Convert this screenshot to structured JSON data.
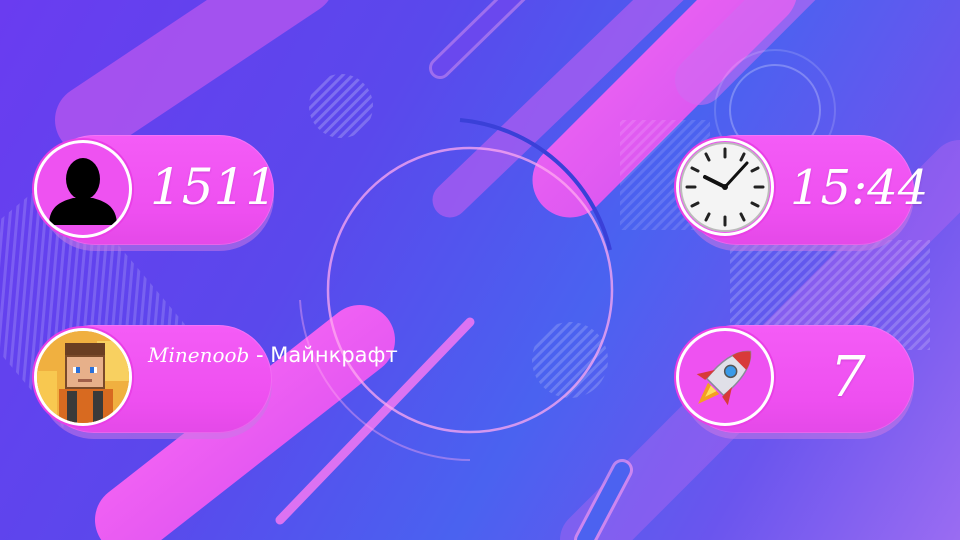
{
  "online_count": "1511",
  "clock_time": "15:44",
  "boost_count": "7",
  "server": {
    "name_part1": "Minenoob",
    "name_part2": " - Майнкрафт"
  },
  "icons": {
    "players": "person-silhouette-icon",
    "clock": "analog-clock-icon",
    "avatar": "minecraft-skin-avatar",
    "boost": "rocket-icon"
  },
  "colors": {
    "pill": "#f050f2",
    "background_from": "#6a3cf0",
    "background_to": "#4a62f0",
    "text": "#ffffff"
  }
}
